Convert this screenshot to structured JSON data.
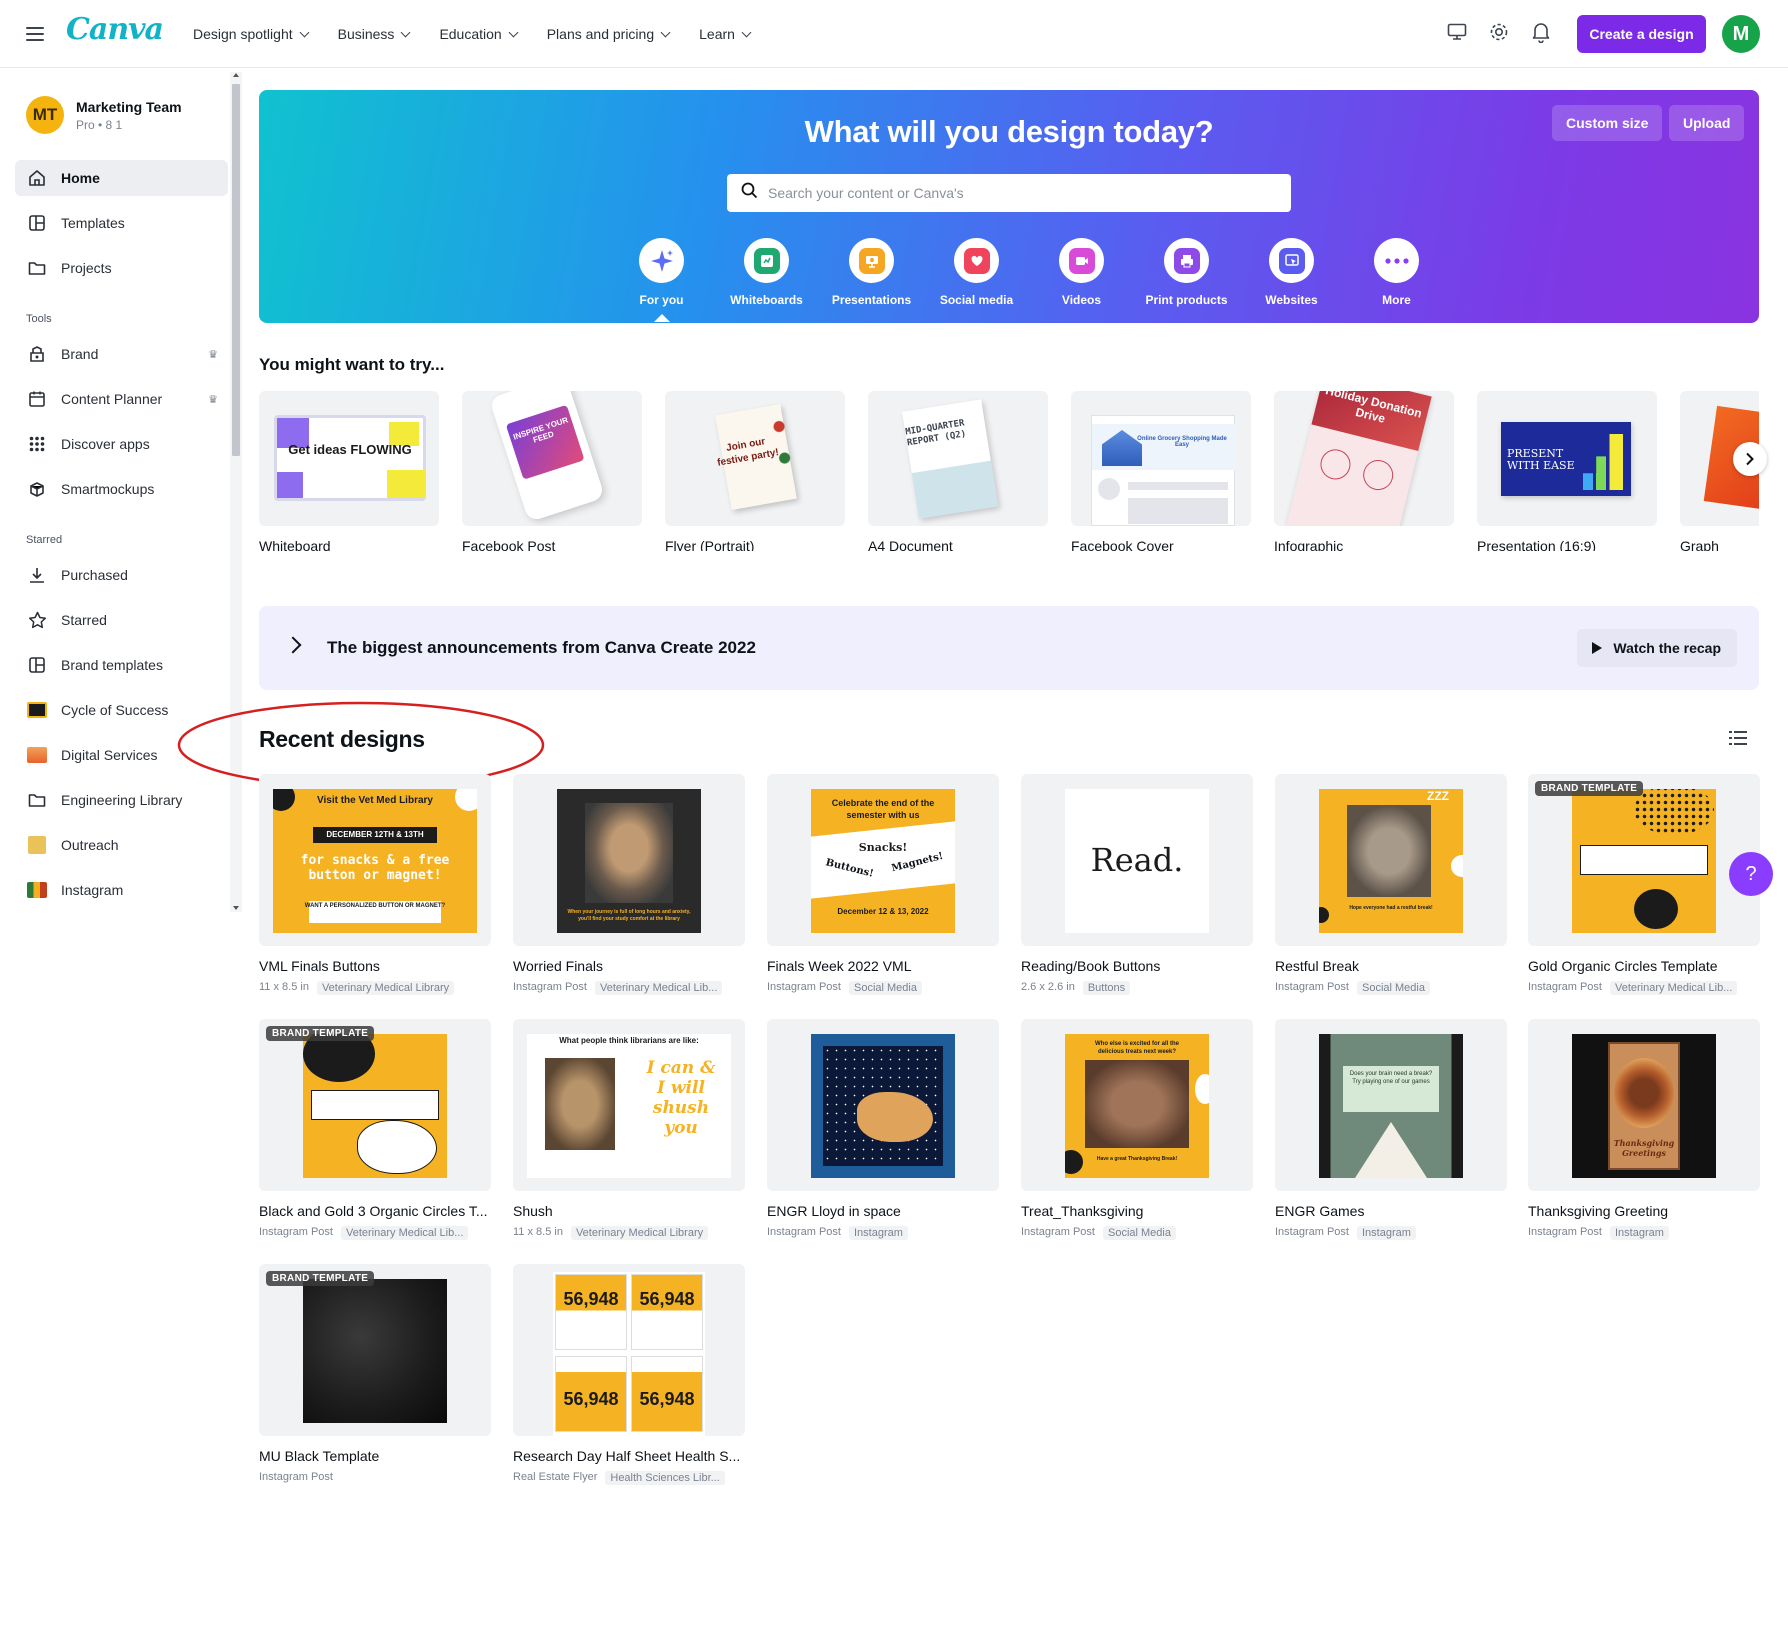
{
  "topbar": {
    "logo": "Canva",
    "nav": [
      {
        "label": "Design spotlight"
      },
      {
        "label": "Business"
      },
      {
        "label": "Education"
      },
      {
        "label": "Plans and pricing"
      },
      {
        "label": "Learn"
      }
    ],
    "create_label": "Create a design",
    "avatar_letter": "M"
  },
  "sidebar": {
    "team_initials": "MT",
    "team_name": "Marketing Team",
    "team_sub": "Pro • 8 1",
    "items_main": [
      {
        "label": "Home"
      },
      {
        "label": "Templates"
      },
      {
        "label": "Projects"
      }
    ],
    "tools_heading": "Tools",
    "tools": [
      {
        "label": "Brand"
      },
      {
        "label": "Content Planner"
      },
      {
        "label": "Discover apps"
      },
      {
        "label": "Smartmockups"
      }
    ],
    "starred_heading": "Starred",
    "starred": [
      {
        "label": "Purchased"
      },
      {
        "label": "Starred"
      },
      {
        "label": "Brand templates"
      },
      {
        "label": "Cycle of Success"
      },
      {
        "label": "Digital Services"
      },
      {
        "label": "Engineering Library"
      },
      {
        "label": "Outreach"
      },
      {
        "label": "Instagram"
      }
    ]
  },
  "hero": {
    "title": "What will you design today?",
    "custom_size": "Custom size",
    "upload": "Upload",
    "search_placeholder": "Search your content or Canva's",
    "categories": [
      {
        "label": "For you",
        "color": "#5b6cf5"
      },
      {
        "label": "Whiteboards",
        "color": "#1fa971"
      },
      {
        "label": "Presentations",
        "color": "#f5a623"
      },
      {
        "label": "Social media",
        "color": "#f0445c"
      },
      {
        "label": "Videos",
        "color": "#d74bd8"
      },
      {
        "label": "Print products",
        "color": "#8e4ae6"
      },
      {
        "label": "Websites",
        "color": "#5a5cf0"
      },
      {
        "label": "More",
        "color": "#8b3dff"
      }
    ]
  },
  "try": {
    "title": "You might want to try...",
    "items": [
      {
        "label": "Whiteboard",
        "art_text": "Get ideas FLOWING"
      },
      {
        "label": "Facebook Post",
        "art_text": "INSPIRE YOUR FEED"
      },
      {
        "label": "Flyer (Portrait)",
        "art_text": "Join our festive party!"
      },
      {
        "label": "A4 Document",
        "art_text": "MID-QUARTER REPORT (Q2)"
      },
      {
        "label": "Facebook Cover",
        "art_text": "Online Grocery Shopping Made Easy"
      },
      {
        "label": "Infographic",
        "art_text": "Holiday Donation Drive"
      },
      {
        "label": "Presentation (16:9)",
        "art_text": "PRESENT WITH EASE"
      },
      {
        "label": "Graph"
      }
    ]
  },
  "announce": {
    "text": "The biggest announcements from Canva Create 2022",
    "watch": "Watch the recap"
  },
  "recent": {
    "title": "Recent designs",
    "badge": "BRAND TEMPLATE",
    "designs": [
      {
        "name": "VML Finals Buttons",
        "meta1": "11 x 8.5 in",
        "meta2": "Veterinary Medical Library",
        "art": [
          "Visit the Vet Med Library",
          "DECEMBER 12TH & 13TH",
          "for snacks & a free button or magnet!",
          "WANT A PERSONALIZED BUTTON OR MAGNET?"
        ]
      },
      {
        "name": "Worried Finals",
        "meta1": "Instagram Post",
        "meta2": "Veterinary Medical Lib...",
        "art": [
          "When your journey is full of long hours and anxiety, you'll find your study comfort at the library"
        ]
      },
      {
        "name": "Finals Week 2022 VML",
        "meta1": "Instagram Post",
        "meta2": "Social Media",
        "art": [
          "Celebrate the end of the semester with us",
          "Snacks!",
          "Buttons!",
          "Magnets!",
          "December 12 & 13, 2022"
        ]
      },
      {
        "name": "Reading/Book Buttons",
        "meta1": "2.6 x 2.6 in",
        "meta2": "Buttons",
        "art": [
          "Read."
        ]
      },
      {
        "name": "Restful Break",
        "meta1": "Instagram Post",
        "meta2": "Social Media",
        "art": [
          "ZZZ",
          "Hope everyone had a restful break!"
        ]
      },
      {
        "name": "Gold Organic Circles Template",
        "meta1": "Instagram Post",
        "meta2": "Veterinary Medical Lib...",
        "badge": true
      },
      {
        "name": "Black and Gold 3 Organic Circles T...",
        "meta1": "Instagram Post",
        "meta2": "Veterinary Medical Lib...",
        "badge": true
      },
      {
        "name": "Shush",
        "meta1": "11 x 8.5 in",
        "meta2": "Veterinary Medical Library",
        "art": [
          "What people think librarians are like:",
          "I can & I will shush you"
        ]
      },
      {
        "name": "ENGR Lloyd in space",
        "meta1": "Instagram Post",
        "meta2": "Instagram"
      },
      {
        "name": "Treat_Thanksgiving",
        "meta1": "Instagram Post",
        "meta2": "Social Media",
        "art": [
          "Who else is excited for all the delicious treats next week?",
          "Have a great Thanksgiving Break!"
        ]
      },
      {
        "name": "ENGR Games",
        "meta1": "Instagram Post",
        "meta2": "Instagram",
        "art": [
          "Does your brain need a break? Try playing one of our games"
        ]
      },
      {
        "name": "Thanksgiving Greeting",
        "meta1": "Instagram Post",
        "meta2": "Instagram",
        "art": [
          "Thanksgiving Greetings"
        ]
      },
      {
        "name": "MU Black Template",
        "meta1": "Instagram Post",
        "meta2": "",
        "badge": true
      },
      {
        "name": "Research Day Half Sheet Health S...",
        "meta1": "Real Estate Flyer",
        "meta2": "Health Sciences Libr...",
        "art": [
          "56,948"
        ]
      }
    ]
  },
  "help": "?"
}
